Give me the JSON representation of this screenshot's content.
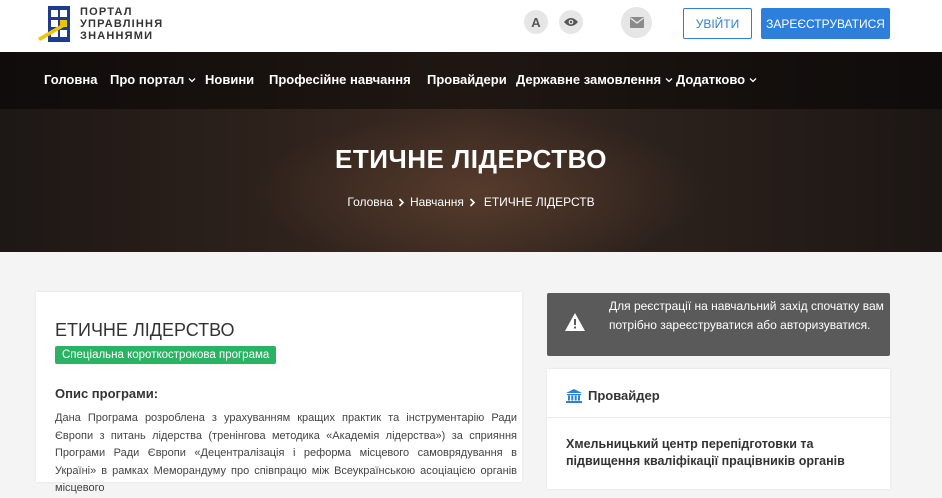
{
  "header": {
    "logo_text_line1": "ПОРТАЛ",
    "logo_text_line2": "УПРАВЛІННЯ",
    "logo_text_line3": "ЗНАННЯМИ",
    "font_size_button_label": "A",
    "login_label": "УВІЙТИ",
    "register_label": "ЗАРЕЄСТРУВАТИСЯ",
    "accent_color": "#2d7fdd"
  },
  "nav": {
    "items": [
      {
        "label": "Головна",
        "has_dropdown": false
      },
      {
        "label": "Про портал",
        "has_dropdown": true
      },
      {
        "label": "Новини",
        "has_dropdown": false
      },
      {
        "label": "Професійне навчання",
        "has_dropdown": false
      },
      {
        "label": "Провайдери",
        "has_dropdown": false
      },
      {
        "label": "Державне замовлення",
        "has_dropdown": true
      },
      {
        "label": "Додатково",
        "has_dropdown": true
      }
    ]
  },
  "hero": {
    "title": "ЕТИЧНЕ ЛІДЕРСТВО",
    "breadcrumb": [
      "Головна",
      "Навчання",
      "ЕТИЧНЕ ЛІДЕРСТВ"
    ]
  },
  "course": {
    "title": "ЕТИЧНЕ ЛІДЕРСТВО",
    "badge": "Спеціальна короткострокова програма",
    "badge_color": "#28b463",
    "description_heading": "Опис програми:",
    "description": "Дана Програма розроблена з урахуванням кращих практик та інструментарію Ради Європи з питань лідерства (тренінгова методика «Академія лідерства») за сприяння Програми Ради Європи «Децентралізація і реформа місцевого самоврядування в Україні» в рамках Меморандуму про співпрацю між Всеукраїнською асоціацією органів місцевого"
  },
  "alert": {
    "text": "Для реєстрації на навчальний захід спочатку вам потрібно зареєструватися або авторизуватися."
  },
  "provider": {
    "heading": "Провайдер",
    "name": "Хмельницький центр перепідготовки та підвищення кваліфікації працівників органів"
  },
  "icons": [
    "logo-mark",
    "eye-icon",
    "mail-icon",
    "chevron-down-icon",
    "breadcrumb-separator-icon",
    "warning-icon",
    "institution-icon"
  ]
}
